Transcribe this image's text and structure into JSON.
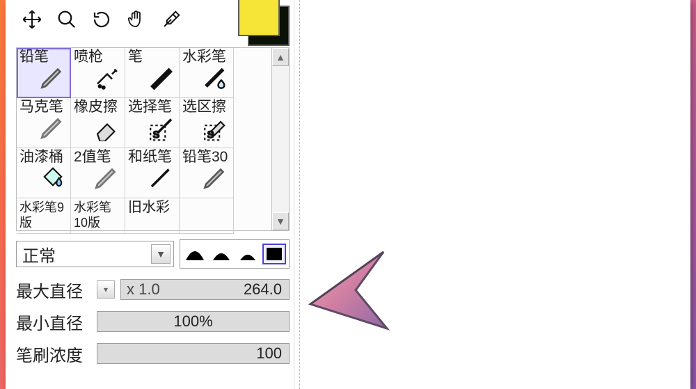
{
  "toolbar": {
    "tools": [
      "move",
      "zoom",
      "rotate",
      "hand",
      "eyedropper"
    ]
  },
  "swatch": {
    "primary": "#f6e536",
    "secondary": "#0b1106"
  },
  "brushes": {
    "rows": [
      [
        {
          "label": "铅笔",
          "icon": "pencil",
          "selected": true
        },
        {
          "label": "喷枪",
          "icon": "airbrush",
          "selected": false
        },
        {
          "label": "笔",
          "icon": "brush",
          "selected": false
        },
        {
          "label": "水彩笔",
          "icon": "water",
          "selected": false
        }
      ],
      [
        {
          "label": "马克笔",
          "icon": "marker",
          "selected": false
        },
        {
          "label": "橡皮擦",
          "icon": "eraser",
          "selected": false
        },
        {
          "label": "选择笔",
          "icon": "selbrush",
          "selected": false
        },
        {
          "label": "选区擦",
          "icon": "selerase",
          "selected": false
        }
      ],
      [
        {
          "label": "油漆桶",
          "icon": "bucket",
          "selected": false
        },
        {
          "label": "2值笔",
          "icon": "binary",
          "selected": false
        },
        {
          "label": "和纸笔",
          "icon": "paper",
          "selected": false
        },
        {
          "label": "铅笔30",
          "icon": "pencil",
          "selected": false
        }
      ],
      [
        {
          "label": "水彩笔9版",
          "icon": "water",
          "selected": false
        },
        {
          "label": "水彩笔10版",
          "icon": "water",
          "selected": false
        },
        {
          "label": "旧水彩",
          "icon": "water",
          "selected": false
        },
        {
          "label": "",
          "icon": "",
          "selected": false
        }
      ]
    ]
  },
  "blend": {
    "mode": "正常"
  },
  "brush_shape": {
    "selected": 3
  },
  "params": {
    "max_size": {
      "label": "最大直径",
      "multiplier": "x 1.0",
      "value": "264.0"
    },
    "min_size": {
      "label": "最小直径",
      "value": "100%"
    },
    "density": {
      "label": "笔刷浓度",
      "value": "100"
    }
  }
}
